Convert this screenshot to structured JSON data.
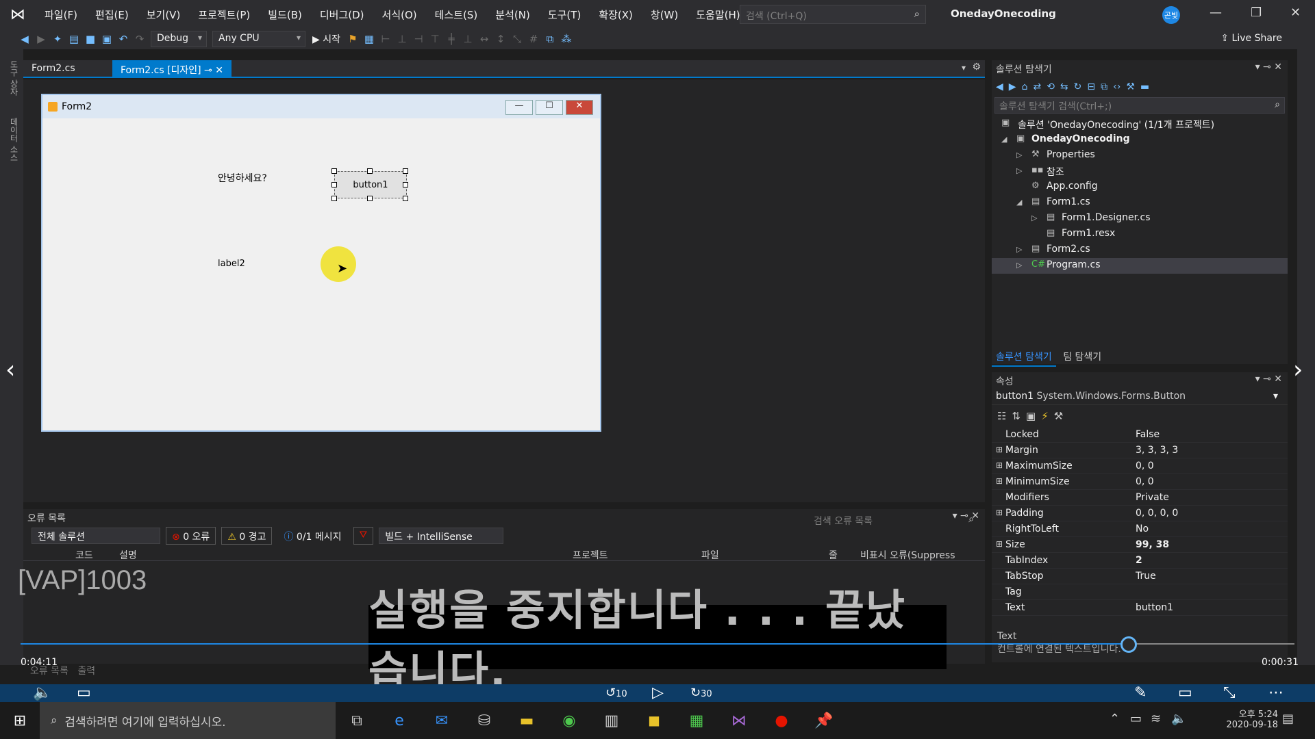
{
  "app": {
    "solution_title": "OnedayOnecoding",
    "avatar_initials": "곤빛",
    "quick_search_placeholder": "검색 (Ctrl+Q)",
    "live_share": "Live Share"
  },
  "menu": [
    "파일(F)",
    "편집(E)",
    "보기(V)",
    "프로젝트(P)",
    "빌드(B)",
    "디버그(D)",
    "서식(O)",
    "테스트(S)",
    "분석(N)",
    "도구(T)",
    "확장(X)",
    "창(W)",
    "도움말(H)"
  ],
  "toolbar": {
    "config": "Debug",
    "platform": "Any CPU",
    "start": "▶ 시작"
  },
  "leftstrip": {
    "a": "도구 상자",
    "b": "데이터 소스"
  },
  "tabs": [
    {
      "label": "Form2.cs"
    },
    {
      "label": "Form2.cs [디자인]"
    }
  ],
  "form": {
    "title": "Form2",
    "label1": "안녕하세요?",
    "label2": "label2",
    "button1": "button1"
  },
  "solution_explorer": {
    "title": "솔루션 탐색기",
    "search": "솔루션 탐색기 검색(Ctrl+;)",
    "items": [
      "솔루션 'OnedayOnecoding' (1/1개 프로젝트)",
      "OnedayOnecoding",
      "Properties",
      "참조",
      "App.config",
      "Form1.cs",
      "Form1.Designer.cs",
      "Form1.resx",
      "Form2.cs",
      "Program.cs"
    ],
    "bottom_tabs": [
      "솔루션 탐색기",
      "팀 탐색기"
    ]
  },
  "properties": {
    "title": "속성",
    "object": "button1",
    "object_type": "System.Windows.Forms.Button",
    "rows": [
      {
        "name": "Locked",
        "value": "False"
      },
      {
        "name": "Margin",
        "value": "3, 3, 3, 3"
      },
      {
        "name": "MaximumSize",
        "value": "0, 0"
      },
      {
        "name": "MinimumSize",
        "value": "0, 0"
      },
      {
        "name": "Modifiers",
        "value": "Private"
      },
      {
        "name": "Padding",
        "value": "0, 0, 0, 0"
      },
      {
        "name": "RightToLeft",
        "value": "No"
      },
      {
        "name": "Size",
        "value": "99, 38"
      },
      {
        "name": "TabIndex",
        "value": "2"
      },
      {
        "name": "TabStop",
        "value": "True"
      },
      {
        "name": "Tag",
        "value": ""
      },
      {
        "name": "Text",
        "value": "button1"
      }
    ],
    "desc_title": "Text",
    "desc_text": "컨트롤에 연결된 텍스트입니다."
  },
  "errorlist": {
    "title": "오류 목록",
    "scope": "전체 솔루션",
    "errors": "0 오류",
    "warnings": "0 경고",
    "messages": "0/1 메시지",
    "build": "빌드 + IntelliSense",
    "search": "검색 오류 목록",
    "cols": [
      "코드",
      "설명",
      "프로젝트",
      "파일",
      "줄",
      "비표시 오류(Suppress"
    ],
    "bottom_tabs": [
      "오류 목록",
      "출력"
    ]
  },
  "overlay": {
    "watermark": "[VAP]1003",
    "subtitle": "실행을 중지합니다 . . . 끝났습니다.",
    "time_current": "0:04:11",
    "time_duration": "0:00:31",
    "progress": 0.87,
    "skip_back": "10",
    "skip_fwd": "30"
  },
  "taskbar": {
    "search": "검색하려면 여기에 입력하십시오.",
    "time": "오후 5:24",
    "date": "2020-09-18"
  }
}
